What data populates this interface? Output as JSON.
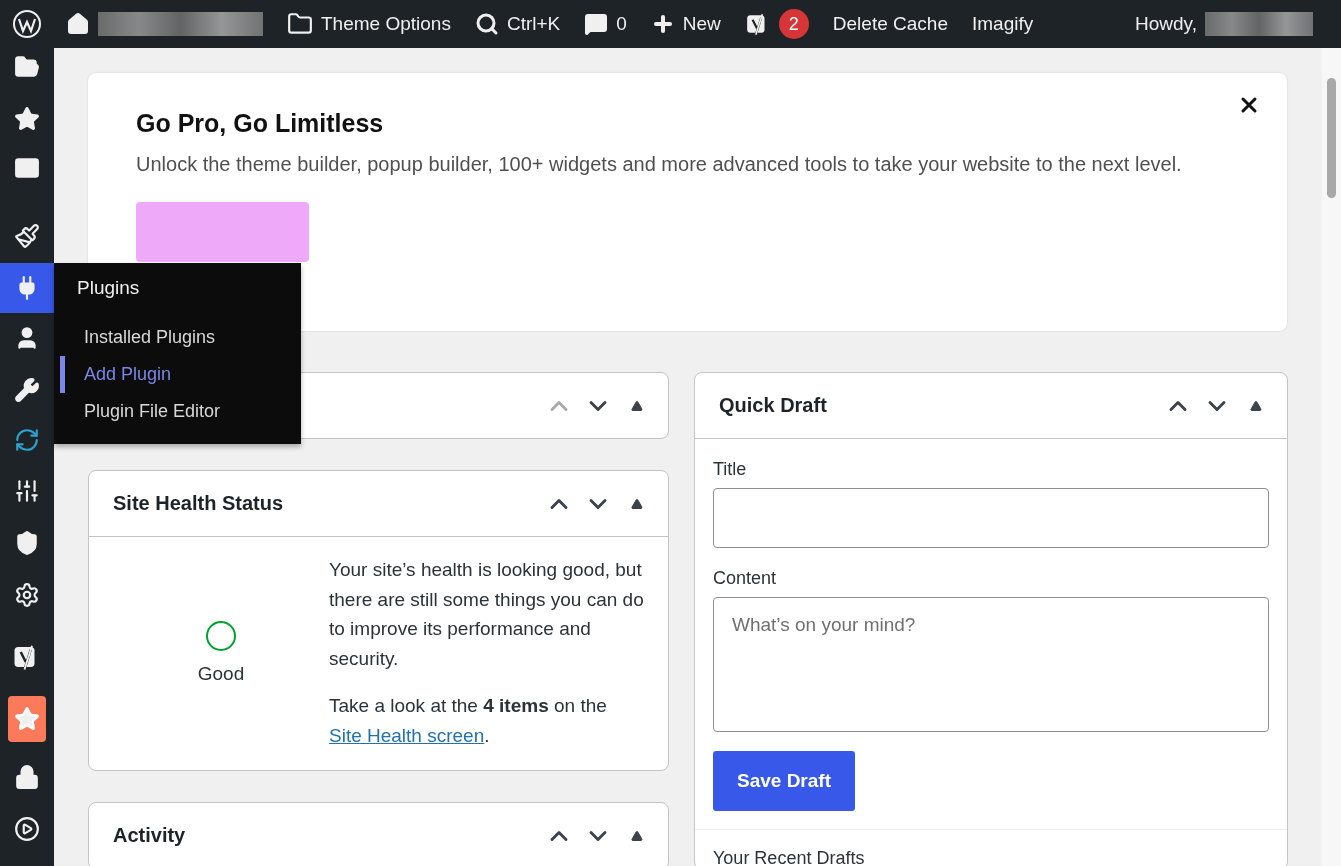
{
  "admin_bar": {
    "theme_options": "Theme Options",
    "search": "Ctrl+K",
    "comments": "0",
    "new": "New",
    "seo_badge": "2",
    "delete_cache": "Delete Cache",
    "imagify": "Imagify",
    "howdy": "Howdy,"
  },
  "sidebar": {
    "items": [
      {
        "selected": false
      },
      {
        "selected": false
      },
      {
        "selected": false
      },
      {
        "selected": false
      },
      {
        "selected": true
      },
      {
        "selected": false
      },
      {
        "selected": false
      },
      {
        "selected": false
      },
      {
        "selected": false
      },
      {
        "selected": false
      },
      {
        "selected": false
      },
      {
        "selected": false
      },
      {
        "selected": false
      },
      {
        "selected": false
      },
      {
        "selected": false
      }
    ]
  },
  "flyout": {
    "title": "Plugins",
    "items": [
      {
        "label": "Installed Plugins",
        "selected": false
      },
      {
        "label": "Add Plugin",
        "selected": true
      },
      {
        "label": "Plugin File Editor",
        "selected": false
      }
    ]
  },
  "banner": {
    "title": "Go Pro, Go Limitless",
    "text": "Unlock the theme builder, popup builder, 100+ widgets and more advanced tools to take your website to the next level."
  },
  "left_column": [
    {
      "kind": "hidden",
      "move_up_disabled": true
    },
    {
      "kind": "health",
      "title": "Site Health Status",
      "move_up_disabled": false,
      "status": "Good",
      "text": "Your site’s health is looking good, but there are still some things you can do to improve its performance and security.",
      "note_prefix": "Take a look at the **4 items** on the",
      "note_link": "Site Health screen",
      "note_suffix": "."
    },
    {
      "kind": "plain",
      "title": "Activity",
      "move_up_disabled": false
    }
  ],
  "quick_draft": {
    "title": "Quick Draft",
    "move_up_disabled": false,
    "title_label": "Title",
    "content_label": "Content",
    "content_placeholder": "What’s on your mind?",
    "save_button": "Save Draft",
    "recent_drafts": "Your Recent Drafts"
  }
}
